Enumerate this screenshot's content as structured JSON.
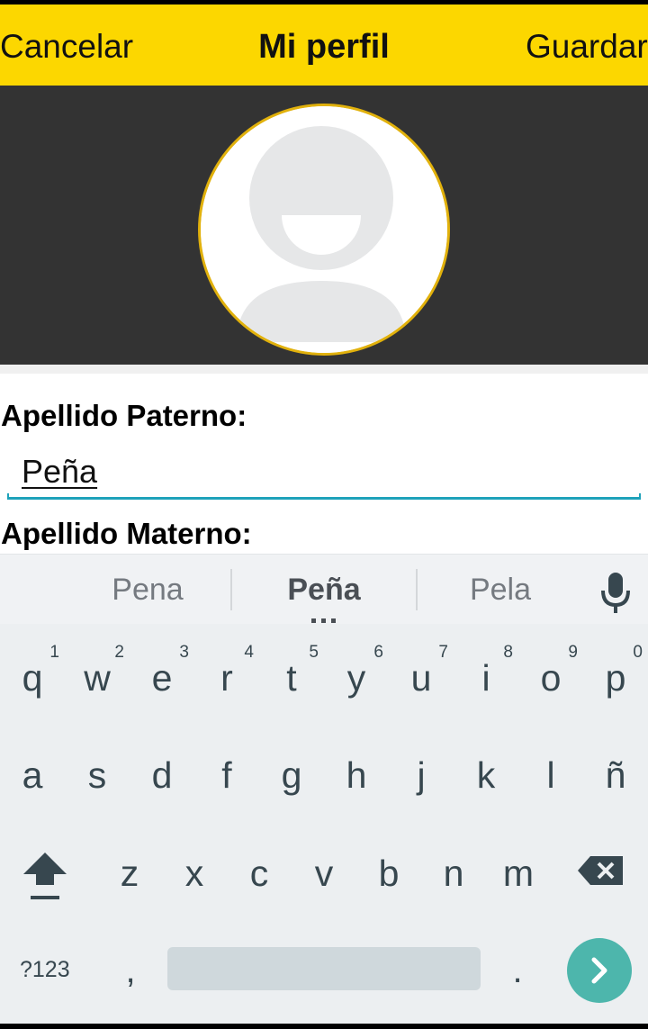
{
  "header": {
    "cancel_label": "Cancelar",
    "title": "Mi perfil",
    "save_label": "Guardar"
  },
  "colors": {
    "header_bg": "#fcd700",
    "photo_bg": "#333333",
    "field_accent": "#1ea2ba",
    "go_button": "#4db6ac"
  },
  "avatar": {
    "icon": "default-user-avatar-icon"
  },
  "form": {
    "apellido_paterno_label": "Apellido Paterno:",
    "apellido_paterno_value": "Peña",
    "apellido_materno_label": "Apellido Materno:"
  },
  "keyboard": {
    "suggestions": [
      "Pena",
      "Peña",
      "Pela"
    ],
    "row1": [
      {
        "key": "q",
        "hint": "1"
      },
      {
        "key": "w",
        "hint": "2"
      },
      {
        "key": "e",
        "hint": "3"
      },
      {
        "key": "r",
        "hint": "4"
      },
      {
        "key": "t",
        "hint": "5"
      },
      {
        "key": "y",
        "hint": "6"
      },
      {
        "key": "u",
        "hint": "7"
      },
      {
        "key": "i",
        "hint": "8"
      },
      {
        "key": "o",
        "hint": "9"
      },
      {
        "key": "p",
        "hint": "0"
      }
    ],
    "row2": [
      "a",
      "s",
      "d",
      "f",
      "g",
      "h",
      "j",
      "k",
      "l",
      "ñ"
    ],
    "row3": [
      "z",
      "x",
      "c",
      "v",
      "b",
      "n",
      "m"
    ],
    "symbols_label": "?123",
    "comma": ",",
    "period": ".",
    "icons": {
      "shift": "shift-icon",
      "backspace": "backspace-icon",
      "mic": "mic-icon",
      "go": "chevron-right-icon"
    }
  }
}
